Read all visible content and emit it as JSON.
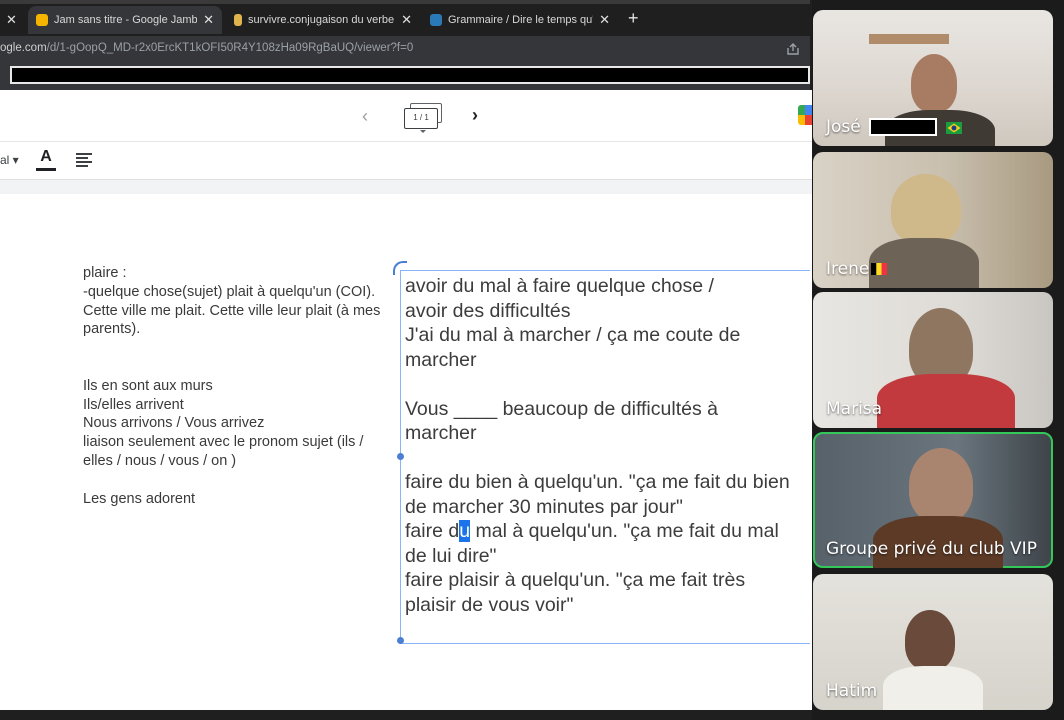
{
  "browser": {
    "tabs": [
      {
        "title": "",
        "close": "✕"
      },
      {
        "title": "Jam sans titre - Google Jamboard",
        "close": "✕"
      },
      {
        "title": "survivre.conjugaison du verbe survivre",
        "close": "✕"
      },
      {
        "title": "Grammaire / Dire le temps qu'il fait",
        "close": "✕"
      }
    ],
    "new_tab": "+",
    "url_host": "ogle.com",
    "url_path": "/d/1-gOopQ_MD-r2x0ErcKT1kOFI50R4Y108zHa09RgBaUQ/viewer?f=0"
  },
  "jamboard": {
    "frame_counter": "1 / 1",
    "font_name": "al",
    "text_color_letter": "A",
    "sticky_text": "plaire :\n-quelque chose(sujet) plait à quelqu'un (COI).\nCette ville me plait. Cette ville leur plait (à mes parents).\n\n\nIls en sont aux murs\nIls/elles arrivent\nNous arrivons / Vous arrivez\nliaison seulement avec le pronom sujet (ils / elles / nous / vous / on )\n\nLes gens adorent",
    "textbox": {
      "l1": "avoir du mal à faire quelque chose /",
      "l2": "avoir des difficultés",
      "l3": "J'ai du mal à marcher / ça me coute de",
      "l4": "marcher",
      "l5": "Vous ____  beaucoup de difficultés à",
      "l6": "marcher",
      "l7": "faire du bien à quelqu'un. \"ça me fait du bien",
      "l8": "de marcher 30 minutes par jour\"",
      "l9_before": "faire d",
      "l9_sel": "u",
      "l9_after": " mal à quelqu'un. \"ça me fait du mal",
      "l10": "de lui dire\"",
      "l11": "faire plaisir à quelqu'un. \"ça me fait très",
      "l12": "plaisir de vous voir\""
    }
  },
  "participants": [
    {
      "name": "José",
      "flag": "brazil-flag"
    },
    {
      "name": "Irene",
      "flag": "belgium-flag"
    },
    {
      "name": "Marisa"
    },
    {
      "name": "Groupe privé du club VIP",
      "speaking": true
    },
    {
      "name": "Hatim"
    }
  ],
  "colors": {
    "accent": "#4a7fd4",
    "speaking": "#34c759",
    "selection": "#1a73e8"
  }
}
